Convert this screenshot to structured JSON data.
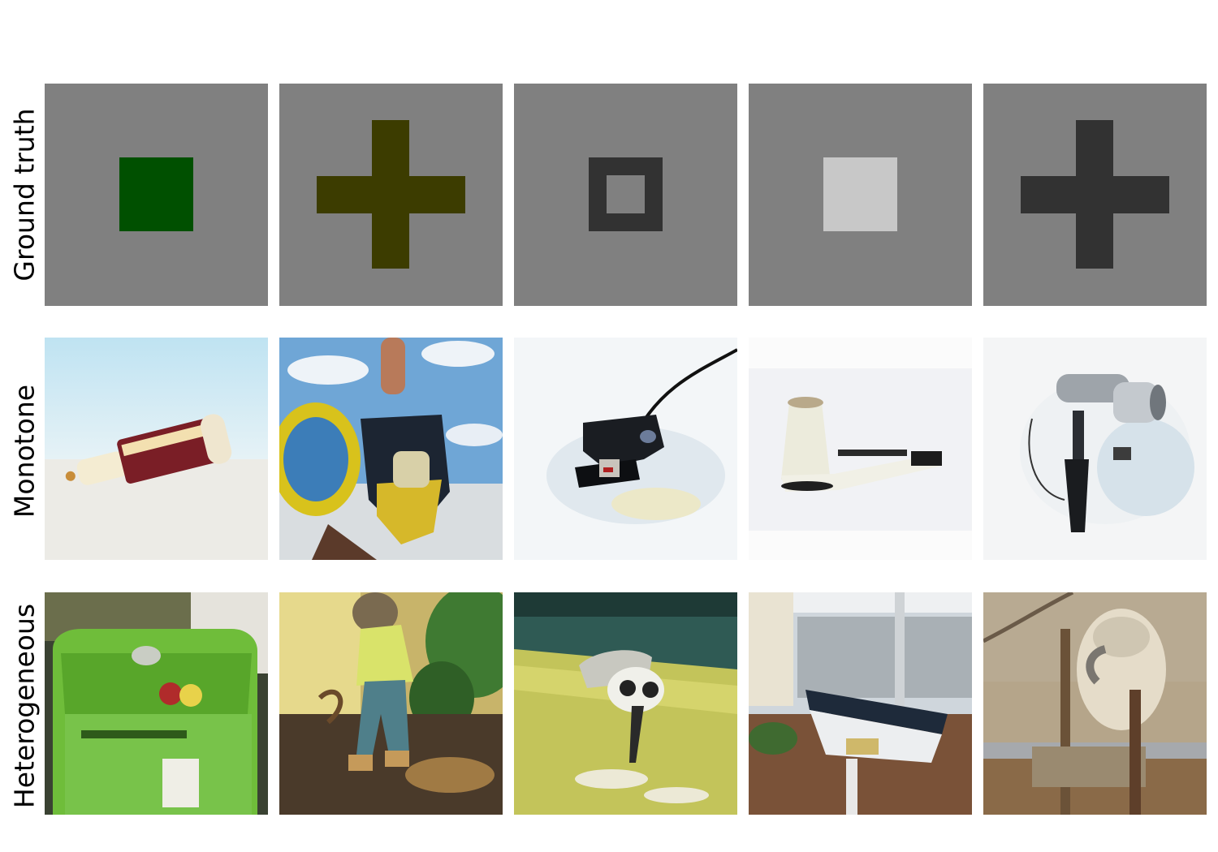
{
  "rows": [
    {
      "label": "Ground truth"
    },
    {
      "label": "Monotone"
    },
    {
      "label": "Heterogeneous"
    }
  ],
  "ground_truth": [
    {
      "shape": "square",
      "color": "#005000"
    },
    {
      "shape": "cross",
      "color": "#3c3c00"
    },
    {
      "shape": "hollow-square",
      "color": "#323232"
    },
    {
      "shape": "square",
      "color": "#c8c8c8"
    },
    {
      "shape": "cross",
      "color": "#323232"
    }
  ],
  "ground_truth_background": "#808080",
  "monotone": [
    {
      "subject": "glue tube"
    },
    {
      "subject": "hand held toy"
    },
    {
      "subject": "black gadget"
    },
    {
      "subject": "hair dryer"
    },
    {
      "subject": "metal device"
    }
  ],
  "heterogeneous": [
    {
      "subject": "green bin"
    },
    {
      "subject": "boy figure"
    },
    {
      "subject": "robot creature"
    },
    {
      "subject": "bench sign"
    },
    {
      "subject": "goat sculpture"
    }
  ]
}
